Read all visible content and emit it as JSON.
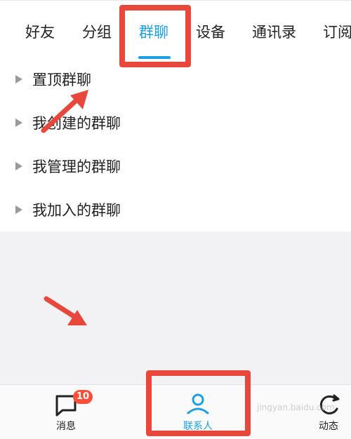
{
  "tabs": [
    {
      "label": "好友"
    },
    {
      "label": "分组"
    },
    {
      "label": "群聊"
    },
    {
      "label": "设备"
    },
    {
      "label": "通讯录"
    },
    {
      "label": "订阅"
    }
  ],
  "active_tab": "群聊",
  "groups": [
    {
      "label": "置顶群聊"
    },
    {
      "label": "我创建的群聊"
    },
    {
      "label": "我管理的群聊"
    },
    {
      "label": "我加入的群聊"
    }
  ],
  "bottom_nav": {
    "messages": {
      "label": "消息",
      "badge": "10"
    },
    "contacts": {
      "label": "联系人"
    },
    "moments": {
      "label": "动态"
    }
  },
  "watermark": "jingyan.baidu.com",
  "colors": {
    "accent": "#1aa0e6",
    "annotation_red": "#e8483b",
    "badge_red": "#ff4e3a"
  }
}
